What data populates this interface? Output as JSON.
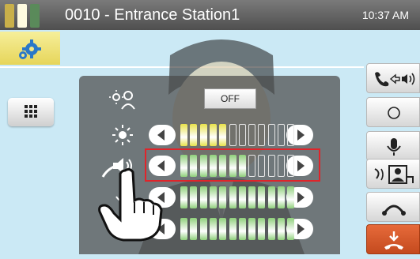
{
  "header": {
    "title": "0010 - Entrance Station1",
    "time": "10:37 AM",
    "status_colors": [
      "#c9b04a",
      "#ffffff",
      "#5a8a5a"
    ]
  },
  "panel": {
    "camera_night_label": "OFF",
    "rows": [
      {
        "name": "brightness",
        "icon": "sun-icon",
        "level_fraction": 0.45,
        "lit_color": "#e8e24a"
      },
      {
        "name": "volume",
        "icon": "speaker-volume-icon",
        "level_fraction": 0.55,
        "lit_color": "#8fd07a"
      },
      {
        "name": "mic",
        "icon": "microphone-level-icon",
        "level_fraction": 1.0,
        "lit_color": "#8fd07a"
      },
      {
        "name": "ring",
        "icon": "ring-volume-icon",
        "level_fraction": 1.0,
        "lit_color": "#8fd07a"
      }
    ]
  },
  "right_buttons": [
    {
      "name": "handset-to-speaker-button",
      "icon": "handset-speaker-icon"
    },
    {
      "name": "record-button",
      "icon": "record-icon"
    },
    {
      "name": "microphone-button",
      "icon": "microphone-icon"
    },
    {
      "name": "transfer-button",
      "icon": "call-transfer-icon"
    },
    {
      "name": "hold-button",
      "icon": "hold-icon"
    },
    {
      "name": "end-call-button",
      "icon": "end-call-icon"
    }
  ],
  "colors": {
    "accent": "#cbe9f5",
    "highlight": "#e0242a",
    "end": "#d2562a"
  }
}
